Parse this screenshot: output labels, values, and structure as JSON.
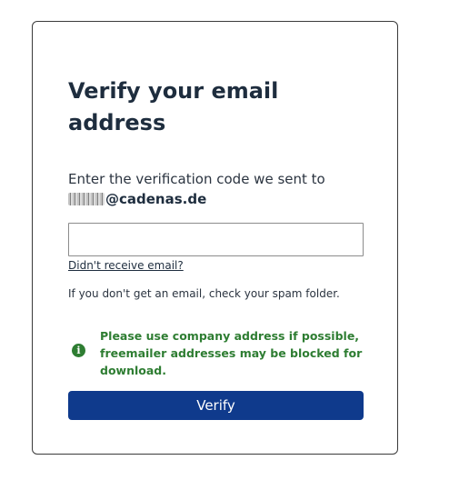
{
  "title": "Verify your email address",
  "instruction": "Enter the verification code we sent to",
  "email_domain": "@cadenas.de",
  "code_input": {
    "value": "",
    "placeholder": ""
  },
  "resend_link": "Didn't receive email?",
  "spam_hint": "If you don't get an email, check your spam folder.",
  "notice": {
    "icon": "info-icon",
    "text": "Please use company address if possible, freemailer addresses may be blocked for download."
  },
  "verify_button": "Verify",
  "colors": {
    "button": "#0f3a8c",
    "notice": "#2e7d32",
    "title": "#1e2d3e"
  }
}
